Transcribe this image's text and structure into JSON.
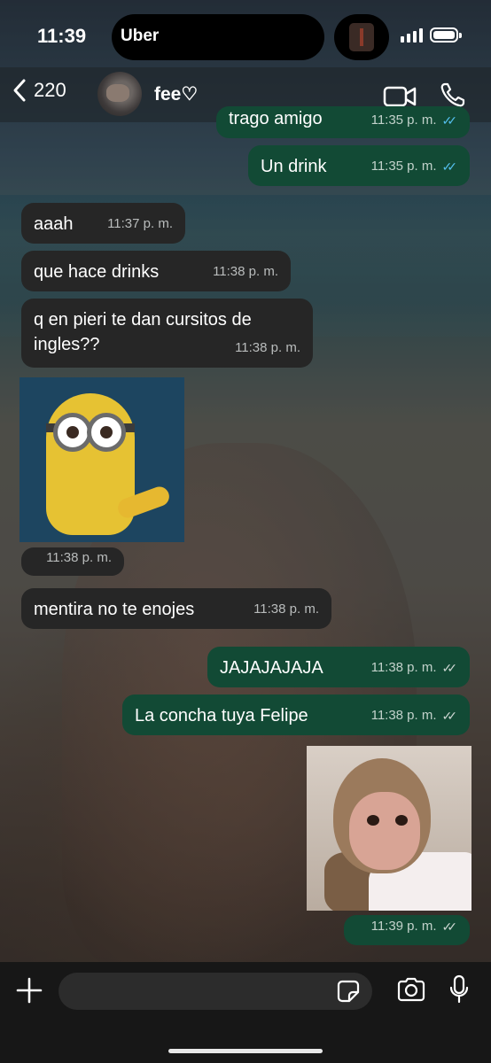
{
  "status_bar": {
    "time": "11:39",
    "live_activity": "Uber"
  },
  "header": {
    "unread_count": "220",
    "contact_name": "fee♡",
    "icons": [
      "back-chevron-icon",
      "video-call-icon",
      "voice-call-icon"
    ]
  },
  "messages": [
    {
      "direction": "out",
      "text": "trago amigo",
      "time": "11:35 p. m.",
      "status": "read"
    },
    {
      "direction": "out",
      "text": "Un drink",
      "time": "11:35 p. m.",
      "status": "read"
    },
    {
      "direction": "in",
      "text": "aaah",
      "time": "11:37 p. m."
    },
    {
      "direction": "in",
      "text": "que hace drinks",
      "time": "11:38 p. m."
    },
    {
      "direction": "in",
      "text": "q en pieri te dan cursitos de ingles??",
      "time": "11:38 p. m."
    },
    {
      "direction": "in",
      "type": "sticker",
      "sticker": "minion",
      "time": "11:38 p. m."
    },
    {
      "direction": "in",
      "text": "mentira no te enojes",
      "time": "11:38 p. m."
    },
    {
      "direction": "out",
      "text": "JAJAJAJAJA",
      "time": "11:38 p. m.",
      "status": "delivered"
    },
    {
      "direction": "out",
      "text": "La concha tuya Felipe",
      "time": "11:38 p. m.",
      "status": "delivered"
    },
    {
      "direction": "out",
      "type": "sticker",
      "sticker": "monkey",
      "time": "11:39 p. m.",
      "status": "delivered"
    }
  ],
  "colors": {
    "incoming_bubble": "#262626",
    "outgoing_bubble": "#124a35",
    "read_tick": "#53bdeb",
    "input_bar": "#171717"
  },
  "composer": {
    "placeholder": "",
    "icons": [
      "plus-icon",
      "sticker-icon",
      "camera-icon",
      "microphone-icon"
    ]
  }
}
